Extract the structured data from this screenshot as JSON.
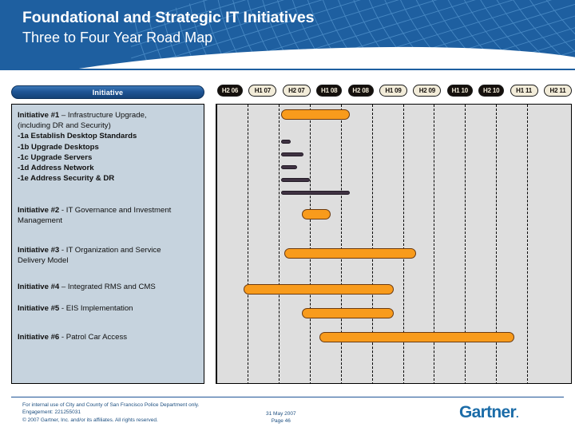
{
  "header": {
    "title": "Foundational and Strategic IT Initiatives",
    "subtitle": "Three to Four Year Road Map",
    "background_color": "#1e5fa0"
  },
  "table": {
    "column_header": "Initiative"
  },
  "chart_data": {
    "type": "bar",
    "chart_kind": "gantt",
    "title": "Foundational and Strategic IT Initiatives — Three to Four Year Road Map",
    "xlabel": "",
    "ylabel": "Initiative",
    "grid": true,
    "legend": "none",
    "bar_color": "#f89b1c",
    "sub_bar_color": "#3f3242",
    "categories": [
      "H2 06",
      "H1 07",
      "H2 07",
      "H1 08",
      "H2 08",
      "H1 09",
      "H2 09",
      "H1 10",
      "H2 10",
      "H1 11",
      "H2 11"
    ],
    "category_styles": [
      "dark",
      "light",
      "light",
      "dark",
      "dark",
      "light",
      "light",
      "dark",
      "dark",
      "light",
      "light"
    ],
    "series": [
      {
        "name": "Initiative #1 – Infrastructure Upgrade, (including DR and Security)",
        "label_lines": [
          "Initiative #1 – Infrastructure Upgrade,",
          "(including DR and Security)"
        ],
        "label_bold_prefix": "Initiative #1",
        "label_rest": " – Infrastructure Upgrade, (including DR and Security)",
        "start": "H2 07",
        "end": "H1 08",
        "style": "major"
      },
      {
        "name": "-1a Establish Desktop Standards",
        "start": "H2 07",
        "end": "H2 07",
        "style": "sub"
      },
      {
        "name": "-1b Upgrade Desktops",
        "start": "H2 07",
        "end": "H2 07",
        "style": "sub"
      },
      {
        "name": "-1c Upgrade Servers",
        "start": "H2 07",
        "end": "H2 07",
        "style": "sub"
      },
      {
        "name": "-1d Address Network",
        "start": "H2 07",
        "end": "H1 08",
        "style": "sub"
      },
      {
        "name": "-1e Address Security & DR",
        "start": "H2 07",
        "end": "H1 08",
        "style": "sub"
      },
      {
        "name": "Initiative #2 - IT Governance and Investment Management",
        "label_bold_prefix": "Initiative #2",
        "label_rest": " - IT Governance and Investment Management",
        "start": "H1 08",
        "end": "H1 08",
        "style": "major"
      },
      {
        "name": "Initiative #3 - IT Organization and Service Delivery Model",
        "label_bold_prefix": "Initiative #3",
        "label_rest": " - IT Organization and Service Delivery Model",
        "start": "H2 07",
        "end": "H2 09",
        "style": "major"
      },
      {
        "name": "Initiative #4 – Integrated RMS and CMS",
        "label_bold_prefix": "Initiative #4",
        "label_rest": " – Integrated RMS and CMS",
        "start": "H1 07",
        "end": "H1 09",
        "style": "major"
      },
      {
        "name": "Initiative #5 - EIS Implementation",
        "label_bold_prefix": "Initiative #5",
        "label_rest": " - EIS Implementation",
        "start": "H2 07",
        "end": "H1 09",
        "style": "major"
      },
      {
        "name": "Initiative #6 -  Patrol Car Access",
        "label_bold_prefix": "Initiative #6",
        "label_rest": " -  Patrol Car Access",
        "start": "H1 08",
        "end": "H1 11",
        "style": "major"
      }
    ]
  },
  "initiatives": [
    {
      "id": "initiative-1",
      "lines": [
        {
          "bold": "Initiative #1",
          "text": " – Infrastructure Upgrade,"
        },
        {
          "bold": "",
          "text": "(including DR and Security)"
        },
        {
          "bold": "-1a Establish Desktop Standards",
          "text": ""
        },
        {
          "bold": "-1b Upgrade Desktops",
          "text": ""
        },
        {
          "bold": "-1c Upgrade Servers",
          "text": ""
        },
        {
          "bold": "-1d Address Network",
          "text": ""
        },
        {
          "bold": "-1e Address Security & DR",
          "text": ""
        }
      ]
    },
    {
      "id": "initiative-2",
      "lines": [
        {
          "bold": "Initiative #2",
          "text": " - IT Governance and Investment"
        },
        {
          "bold": "",
          "text": "Management"
        }
      ]
    },
    {
      "id": "initiative-3",
      "lines": [
        {
          "bold": "Initiative #3",
          "text": " - IT Organization and Service"
        },
        {
          "bold": "",
          "text": "Delivery Model"
        }
      ]
    },
    {
      "id": "initiative-4",
      "lines": [
        {
          "bold": "Initiative #4",
          "text": " – Integrated RMS and CMS"
        }
      ]
    },
    {
      "id": "initiative-5",
      "lines": [
        {
          "bold": "Initiative #5",
          "text": " - EIS Implementation"
        }
      ]
    },
    {
      "id": "initiative-6",
      "lines": [
        {
          "bold": "Initiative #6",
          "text": " -  Patrol Car Access"
        }
      ]
    }
  ],
  "footer": {
    "line1": "For internal use of City and County of San Francisco Police Department only.",
    "line2": "Engagement: 221255031",
    "line3": "© 2007 Gartner, Inc. and/or its affiliates. All rights reserved.",
    "date": "31 May 2007",
    "page": "Page 46",
    "logo": "Gartner",
    "logo_color": "#1b6ca8"
  }
}
